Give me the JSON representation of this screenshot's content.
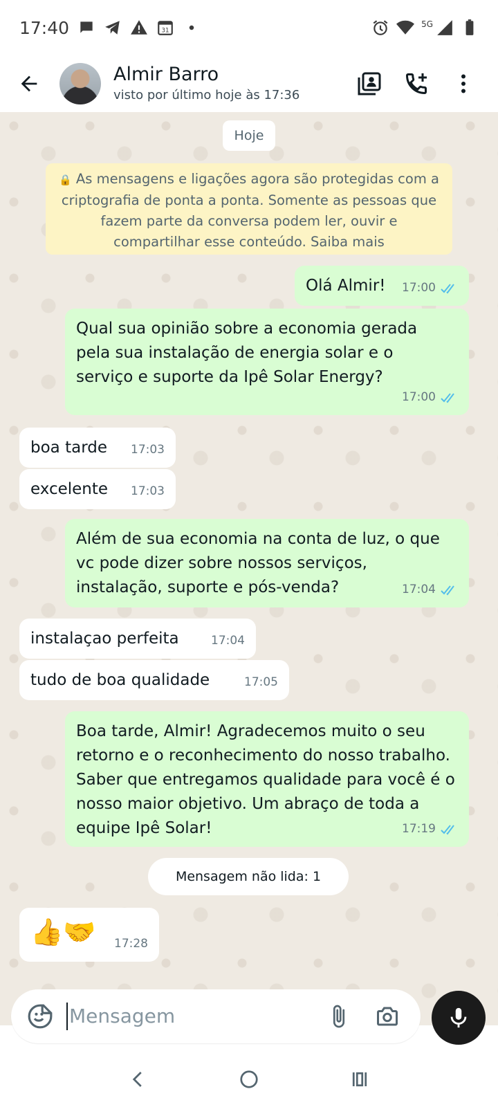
{
  "status_bar": {
    "time": "17:40",
    "network": "5G"
  },
  "header": {
    "contact_name": "Almir Barro",
    "contact_status": "visto por último hoje às 17:36"
  },
  "chat": {
    "date_label": "Hoje",
    "encryption_notice": "As mensagens e ligações agora são protegidas com a criptografia de ponta a ponta. Somente as pessoas que fazem parte da conversa podem ler, ouvir e compartilhar esse conteúdo. Saiba mais",
    "unread_label": "Mensagem não lida: 1",
    "messages": [
      {
        "direction": "out",
        "text": "Olá Almir!",
        "time": "17:00"
      },
      {
        "direction": "out",
        "text": "Qual sua opinião sobre a economia gerada pela sua instalação de energia solar e o serviço e suporte da Ipê Solar Energy?",
        "time": "17:00"
      },
      {
        "direction": "in",
        "text": "boa tarde",
        "time": "17:03"
      },
      {
        "direction": "in",
        "text": "excelente",
        "time": "17:03"
      },
      {
        "direction": "out",
        "text": "Além de sua economia na conta de luz, o que vc pode dizer sobre nossos serviços, instalação, suporte e pós-venda?",
        "time": "17:04"
      },
      {
        "direction": "in",
        "text": "instalaçao perfeita",
        "time": "17:04"
      },
      {
        "direction": "in",
        "text": "tudo de boa qualidade",
        "time": "17:05"
      },
      {
        "direction": "out",
        "text": "Boa tarde, Almir! Agradecemos muito o seu retorno e o reconhecimento do nosso trabalho. Saber que entregamos qualidade para você é o nosso maior objetivo. Um abraço de toda a equipe Ipê Solar!",
        "time": "17:19"
      },
      {
        "direction": "in",
        "text": "👍🤝",
        "time": "17:28"
      }
    ]
  },
  "composer": {
    "placeholder": "Mensagem"
  },
  "colors": {
    "outgoing_bubble": "#d9fdd3",
    "incoming_bubble": "#ffffff",
    "read_ticks": "#53bdeb",
    "chat_background": "#efeae2",
    "notice_background": "#fdf4c5"
  }
}
